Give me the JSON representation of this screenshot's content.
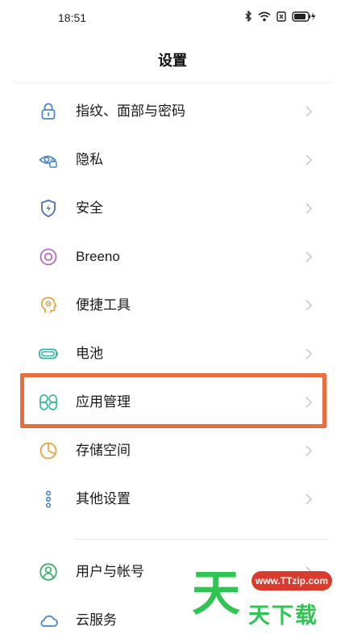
{
  "status_bar": {
    "time": "18:51",
    "icons": [
      "bluetooth-icon",
      "wifi-icon",
      "sim-icon",
      "battery-charging-icon"
    ]
  },
  "header": {
    "title": "设置"
  },
  "settings": {
    "items": [
      {
        "label": "指纹、面部与密码",
        "icon": "lock-icon"
      },
      {
        "label": "隐私",
        "icon": "privacy-eye-icon"
      },
      {
        "label": "安全",
        "icon": "security-shield-icon"
      },
      {
        "label": "Breeno",
        "icon": "breeno-icon"
      },
      {
        "label": "便捷工具",
        "icon": "convenience-tools-icon"
      },
      {
        "label": "电池",
        "icon": "battery-icon"
      },
      {
        "label": "应用管理",
        "icon": "app-management-icon"
      },
      {
        "label": "存储空间",
        "icon": "storage-icon"
      },
      {
        "label": "其他设置",
        "icon": "other-settings-icon"
      },
      {
        "label": "用户与帐号",
        "icon": "user-account-icon"
      },
      {
        "label": "云服务",
        "icon": "cloud-icon"
      }
    ]
  },
  "highlight": {
    "target": "应用管理",
    "color": "#ec6b3e"
  },
  "watermark": {
    "url": "www.TTzip.com",
    "big_char": "天",
    "text": "天下载",
    "color": "#2fc552",
    "url_color": "#d93b2d"
  }
}
